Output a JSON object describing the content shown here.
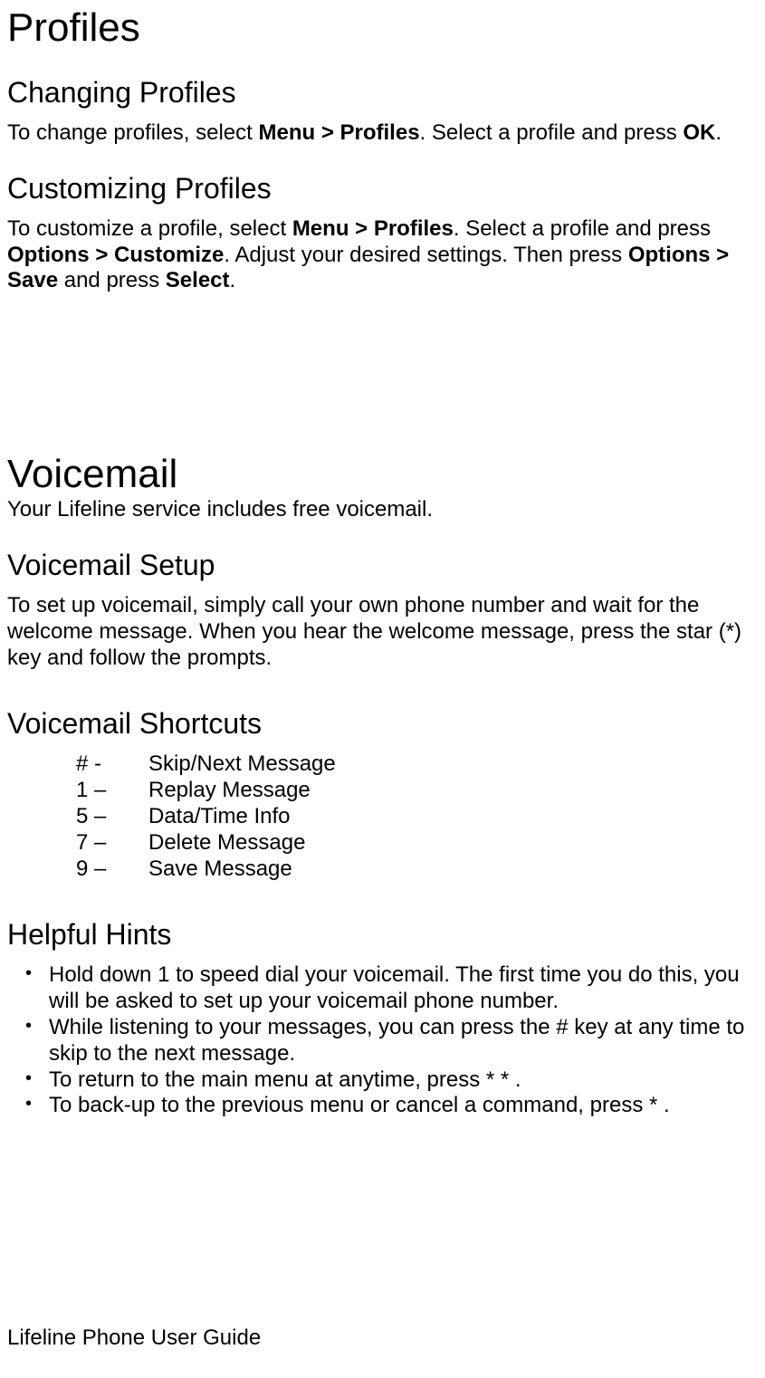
{
  "profiles": {
    "title": "Profiles",
    "changing": {
      "title": "Changing Profiles",
      "text_parts": {
        "p1": "To change profiles, select ",
        "b1": "Menu > Profiles",
        "p2": ". Select a profile and press ",
        "b2": "OK",
        "p3": "."
      }
    },
    "customizing": {
      "title": "Customizing Profiles",
      "text_parts": {
        "p1": "To customize a profile, select ",
        "b1": "Menu > Profiles",
        "p2": ". Select a profile and press ",
        "b2": "Options > Customize",
        "p3": ". Adjust your desired settings. Then press ",
        "b3": "Options > Save",
        "p4": " and press ",
        "b4": "Select",
        "p5": "."
      }
    }
  },
  "voicemail": {
    "title": "Voicemail",
    "intro": "Your Lifeline service includes free voicemail.",
    "setup": {
      "title": "Voicemail Setup",
      "text": "To set up voicemail, simply call your own phone number and wait for the welcome message. When you hear the welcome message, press the star (*) key and follow the prompts."
    },
    "shortcuts": {
      "title": "Voicemail Shortcuts",
      "items": [
        {
          "key": "# -",
          "desc": "Skip/Next Message"
        },
        {
          "key": "1 –",
          "desc": "Replay Message"
        },
        {
          "key": "5 –",
          "desc": "Data/Time Info"
        },
        {
          "key": "7 –",
          "desc": "Delete Message"
        },
        {
          "key": "9 –",
          "desc": "Save Message"
        }
      ]
    },
    "hints": {
      "title": "Helpful Hints",
      "items": [
        "Hold down 1 to speed dial your voicemail. The first time you do this, you will be asked to set up your voicemail phone number.",
        "While listening to your messages, you can press the # key at any time to skip to the next message.",
        "To return to the main menu at anytime, press * * .",
        "To back-up to the previous menu or cancel a command, press * ."
      ]
    }
  },
  "footer": "Lifeline Phone User Guide"
}
